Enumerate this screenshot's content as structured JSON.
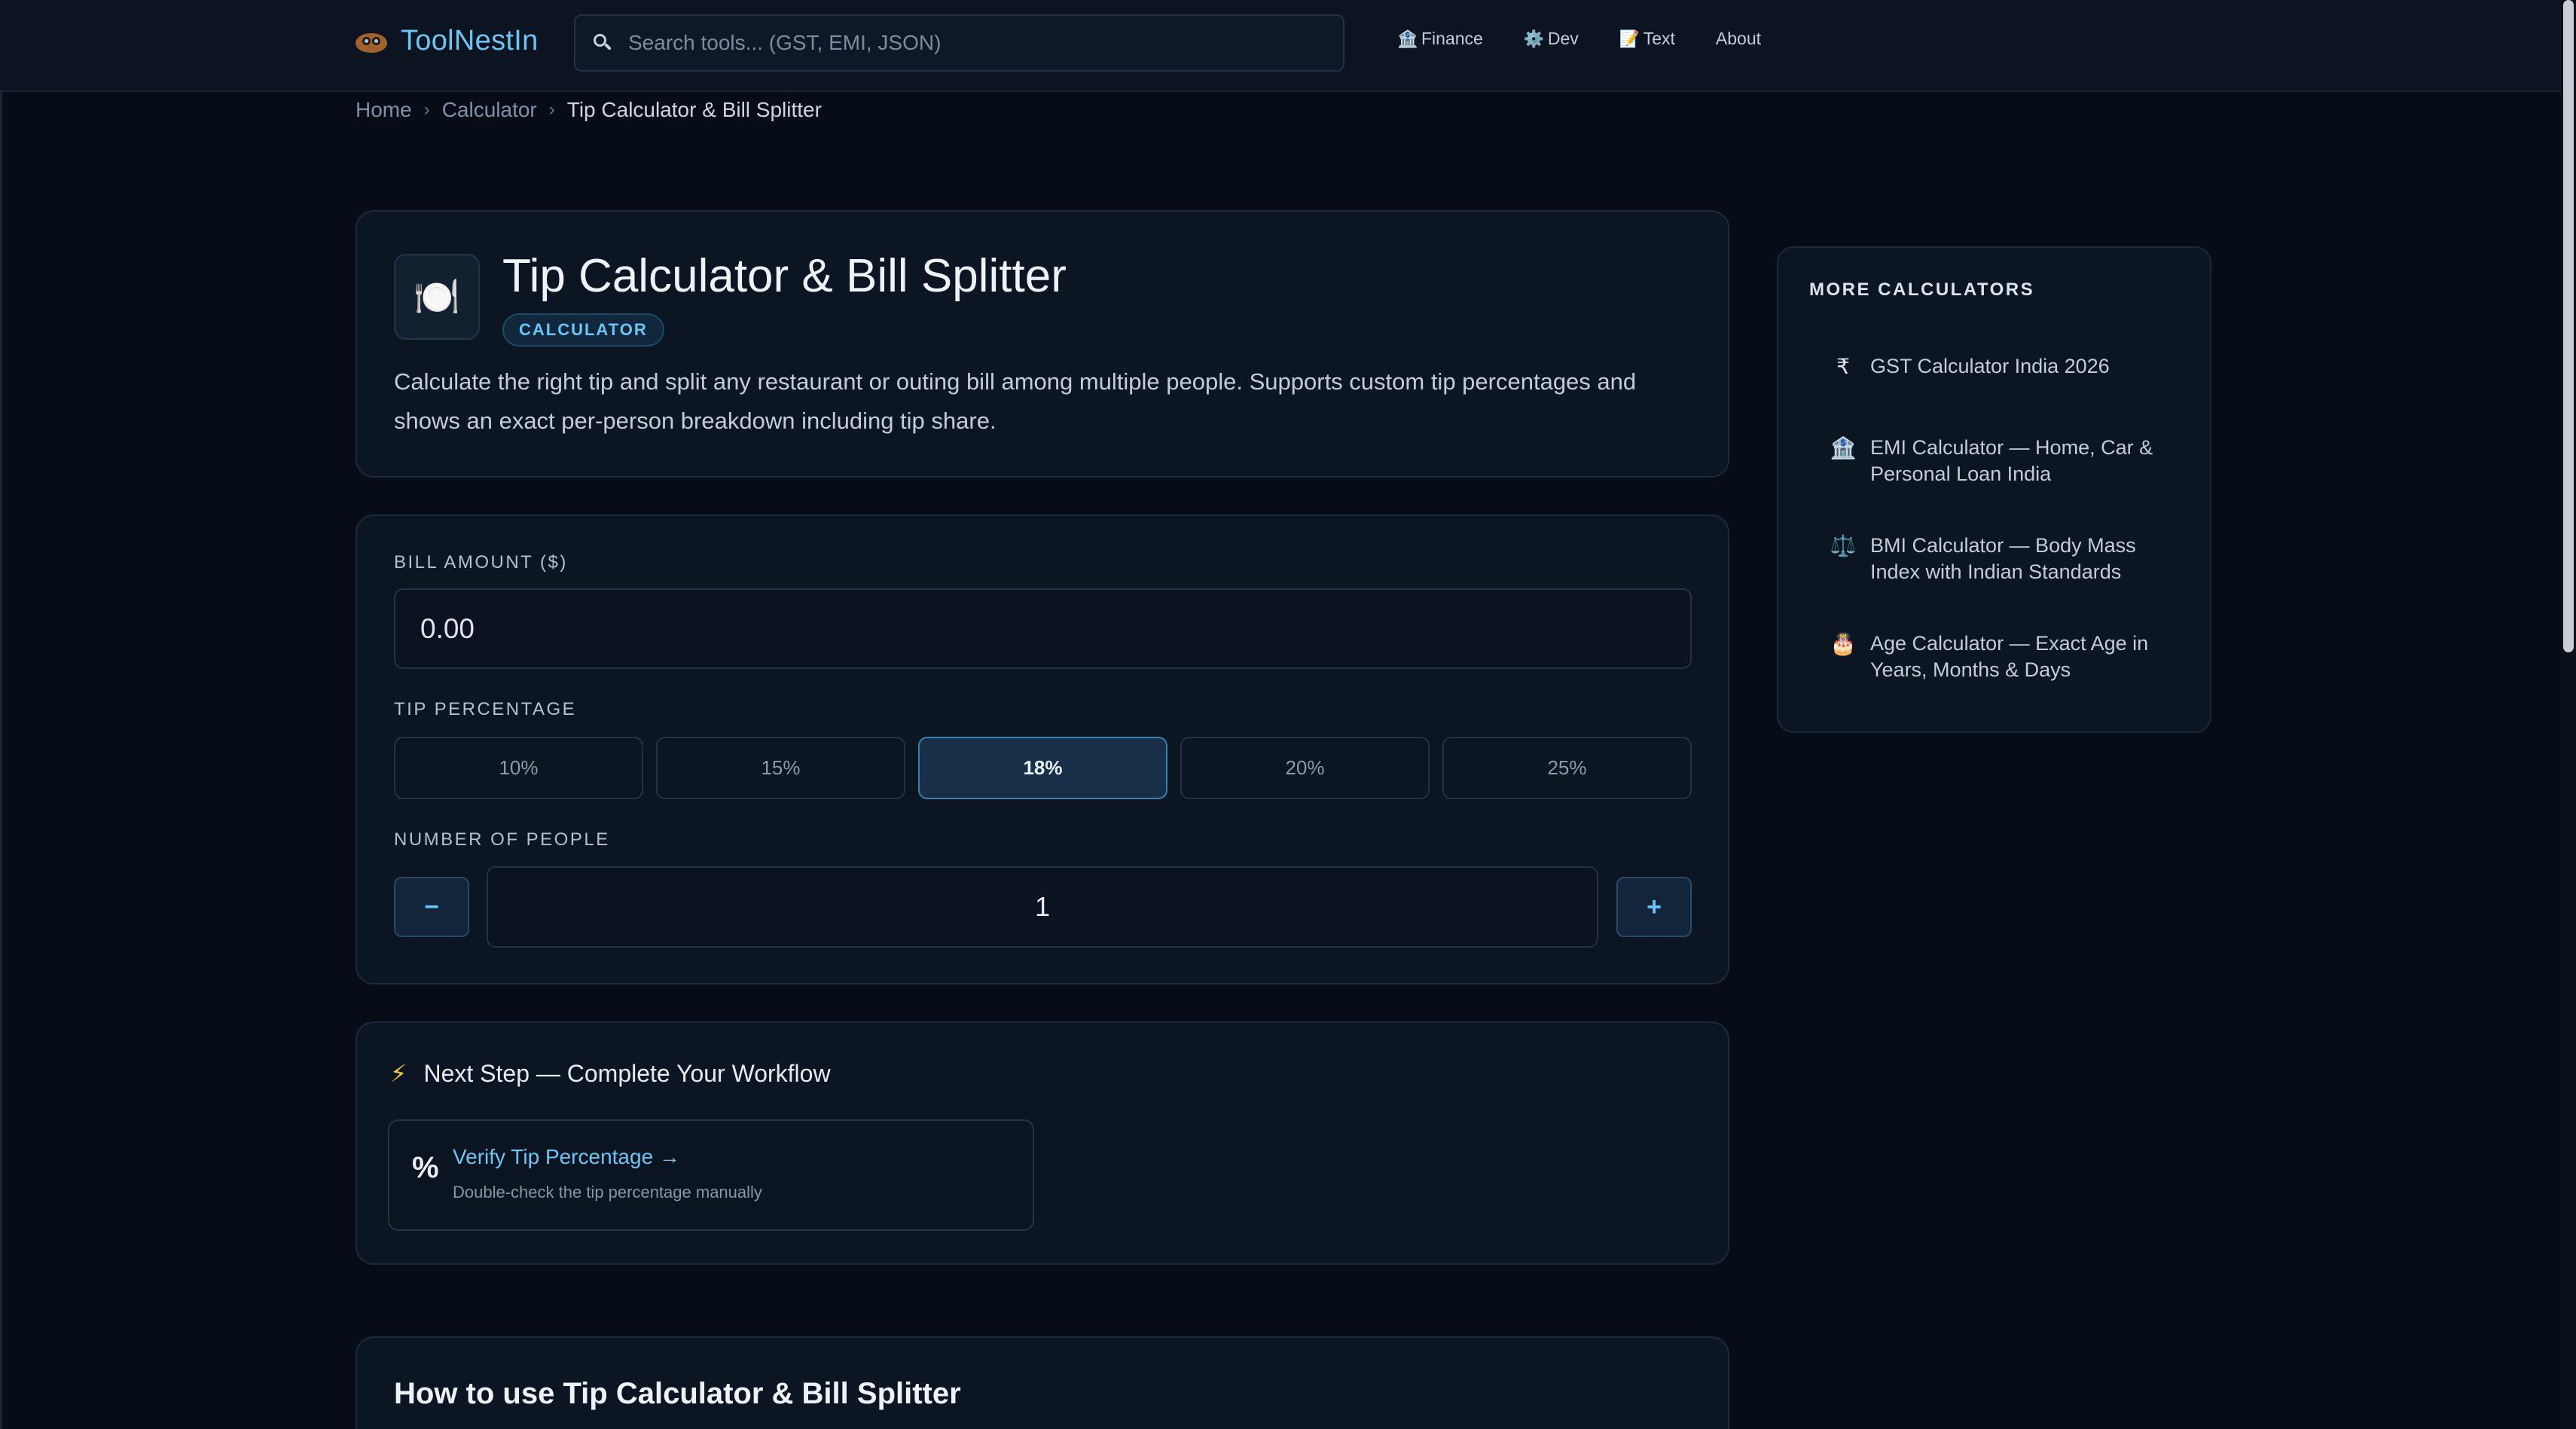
{
  "header": {
    "logo_text": "ToolNestIn",
    "search_placeholder": "Search tools... (GST, EMI, JSON)",
    "nav": [
      {
        "icon": "🏦",
        "icon_name": "bank-icon",
        "label": "Finance"
      },
      {
        "icon": "⚙️",
        "icon_name": "gear-icon",
        "label": "Dev"
      },
      {
        "icon": "📝",
        "icon_name": "memo-icon",
        "label": "Text"
      },
      {
        "icon": "",
        "icon_name": "",
        "label": "About"
      }
    ]
  },
  "breadcrumb": {
    "items": [
      "Home",
      "Calculator",
      "Tip Calculator & Bill Splitter"
    ],
    "separator": "›"
  },
  "tool": {
    "icon": "🍽️",
    "title": "Tip Calculator & Bill Splitter",
    "badge": "CALCULATOR",
    "description": "Calculate the right tip and split any restaurant or outing bill among multiple people. Supports custom tip percentages and shows an exact per-person breakdown including tip share."
  },
  "form": {
    "bill_label": "BILL AMOUNT ($)",
    "bill_value": "0.00",
    "tip_label": "TIP PERCENTAGE",
    "tip_options": [
      "10%",
      "15%",
      "18%",
      "20%",
      "25%"
    ],
    "tip_selected": "18%",
    "people_label": "NUMBER OF PEOPLE",
    "people_value": "1",
    "decrement_label": "−",
    "increment_label": "+"
  },
  "next_step": {
    "icon": "⚡",
    "title": "Next Step — Complete Your Workflow",
    "link_icon": "%",
    "link_title": "Verify Tip Percentage →",
    "link_subtitle": "Double-check the tip percentage manually"
  },
  "howto": {
    "title": "How to use Tip Calculator & Bill Splitter"
  },
  "sidebar": {
    "heading": "MORE CALCULATORS",
    "items": [
      {
        "icon": "₹",
        "icon_name": "rupee-icon",
        "label": "GST Calculator India 2026"
      },
      {
        "icon": "🏦",
        "icon_name": "bank-icon",
        "label": "EMI Calculator — Home, Car & Personal Loan India"
      },
      {
        "icon": "⚖️",
        "icon_name": "scales-icon",
        "label": "BMI Calculator — Body Mass Index with Indian Standards"
      },
      {
        "icon": "🎂",
        "icon_name": "cake-icon",
        "label": "Age Calculator — Exact Age in Years, Months & Days"
      }
    ]
  },
  "colors": {
    "background": "#070d17",
    "card": "#0c1623",
    "accent": "#6cc6f5",
    "selected_tip_bg": "#173048",
    "bolt": "#f4c542"
  }
}
